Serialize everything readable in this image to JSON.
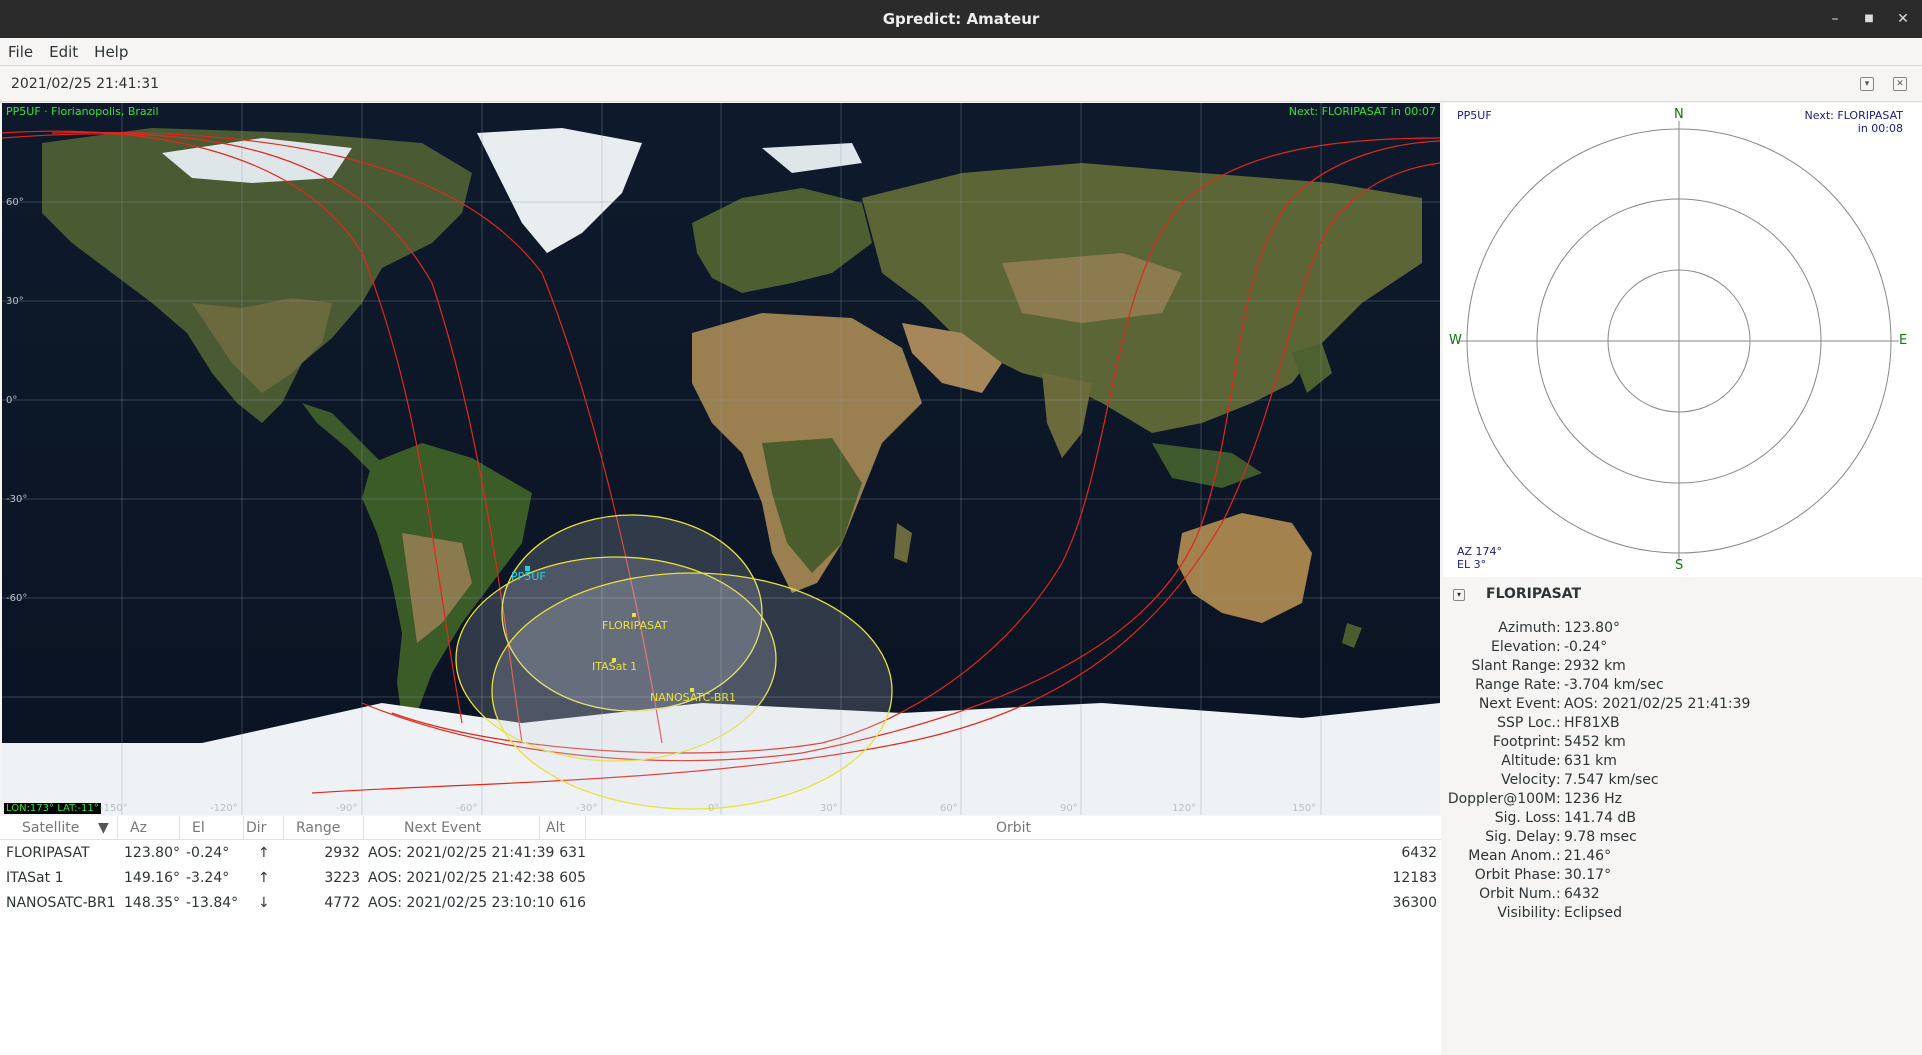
{
  "window": {
    "title": "Gpredict: Amateur"
  },
  "menu": [
    "File",
    "Edit",
    "Help"
  ],
  "timebar": {
    "time": "2021/02/25 21:41:31"
  },
  "map": {
    "qth_label": "PP5UF · Florianopolis, Brazil",
    "next_label": "Next: FLORIPASAT in 00:07",
    "cursor_readout": "LON:173° LAT:-11°",
    "lat_labels": [
      "60°",
      "30°",
      "0°",
      "-30°",
      "-60°"
    ],
    "lon_labels": [
      "-150°",
      "-120°",
      "-90°",
      "-60°",
      "-30°",
      "0°",
      "30°",
      "60°",
      "90°",
      "120°",
      "150°"
    ],
    "ground_station_label": "PP5UF",
    "satellites": [
      "FLORIPASAT",
      "ITASat 1",
      "NANOSATC-BR1"
    ]
  },
  "polar": {
    "qth": "PP5UF",
    "next_line1": "Next: FLORIPASAT",
    "next_line2": "in 00:08",
    "az": "AZ 174°",
    "el": "EL 3°",
    "north": "N",
    "south": "S",
    "east": "E",
    "west": "W"
  },
  "info": {
    "title": "FLORIPASAT",
    "rows": [
      {
        "k": "Azimuth",
        "v": "123.80°"
      },
      {
        "k": "Elevation",
        "v": "-0.24°"
      },
      {
        "k": "Slant Range",
        "v": "2932 km"
      },
      {
        "k": "Range Rate",
        "v": "-3.704 km/sec"
      },
      {
        "k": "Next Event",
        "v": "AOS: 2021/02/25 21:41:39"
      },
      {
        "k": "SSP Loc.",
        "v": "HF81XB"
      },
      {
        "k": "Footprint",
        "v": "5452 km"
      },
      {
        "k": "Altitude",
        "v": "631 km"
      },
      {
        "k": "Velocity",
        "v": "7.547 km/sec"
      },
      {
        "k": "Doppler@100M",
        "v": "1236 Hz"
      },
      {
        "k": "Sig. Loss",
        "v": "141.74 dB"
      },
      {
        "k": "Sig. Delay",
        "v": "9.78 msec"
      },
      {
        "k": "Mean Anom.",
        "v": "21.46°"
      },
      {
        "k": "Orbit Phase",
        "v": "30.17°"
      },
      {
        "k": "Orbit Num.",
        "v": "6432"
      },
      {
        "k": "Visibility",
        "v": "Eclipsed"
      }
    ]
  },
  "table": {
    "headers": {
      "sat": "Satellite",
      "az": "Az",
      "el": "El",
      "dir": "Dir",
      "range": "Range",
      "next": "Next Event",
      "alt": "Alt",
      "orbit": "Orbit"
    },
    "rows": [
      {
        "sat": "FLORIPASAT",
        "az": "123.80°",
        "el": "-0.24°",
        "dir": "↑",
        "range": "2932",
        "next": "AOS: 2021/02/25 21:41:39",
        "alt": "631",
        "orbit": "6432"
      },
      {
        "sat": "ITASat 1",
        "az": "149.16°",
        "el": "-3.24°",
        "dir": "↑",
        "range": "3223",
        "next": "AOS: 2021/02/25 21:42:38",
        "alt": "605",
        "orbit": "12183"
      },
      {
        "sat": "NANOSATC-BR1",
        "az": "148.35°",
        "el": "-13.84°",
        "dir": "↓",
        "range": "4772",
        "next": "AOS: 2021/02/25 23:10:10",
        "alt": "616",
        "orbit": "36300"
      }
    ]
  }
}
